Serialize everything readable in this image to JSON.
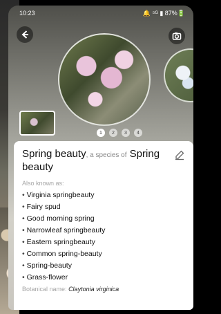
{
  "status_bar": {
    "time": "10:23",
    "indicators": "🔔 ⁵ᴳ ▮ 87%🔋"
  },
  "pager": {
    "pages": [
      "1",
      "2",
      "3",
      "4"
    ],
    "active_index": 0
  },
  "result": {
    "common_name": "Spring beauty",
    "species_connector": ", a species of",
    "species_group": "Spring beauty",
    "also_known_as_label": "Also known as:",
    "alternate_names": [
      "Virginia springbeauty",
      "Fairy spud",
      "Good morning spring",
      "Narrowleaf springbeauty",
      "Eastern springbeauty",
      "Common spring-beauty",
      "Spring-beauty",
      "Grass-flower"
    ],
    "botanical_label": "Botanical name:",
    "botanical_name": "Claytonia virginica"
  },
  "icons": {
    "back": "back-arrow-icon",
    "camera": "camera-icon",
    "edit": "edit-icon"
  }
}
